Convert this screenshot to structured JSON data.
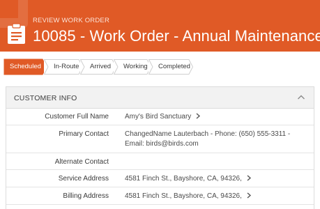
{
  "header": {
    "kicker": "REVIEW WORK ORDER",
    "title": "10085 - Work Order - Annual Maintenance",
    "icon": "clipboard-icon",
    "color": "#e05a26"
  },
  "path": {
    "steps": [
      {
        "label": "Scheduled",
        "active": true
      },
      {
        "label": "In-Route",
        "active": false
      },
      {
        "label": "Arrived",
        "active": false
      },
      {
        "label": "Working",
        "active": false
      },
      {
        "label": "Completed",
        "active": false
      }
    ]
  },
  "customer_info": {
    "title": "CUSTOMER INFO",
    "toggle_icon": "chevron-up-icon",
    "rows": [
      {
        "label": "Customer Full Name",
        "value": "Amy's Bird Sanctuary",
        "link": true
      },
      {
        "label": "Primary Contact",
        "value": "ChangedName Lauterbach - Phone: (650) 555-3311 -",
        "value2": "Email: birds@birds.com",
        "link": false
      },
      {
        "label": "Alternate Contact",
        "value": "",
        "link": false
      },
      {
        "label": "Service Address",
        "value": "4581 Finch St., Bayshore, CA, 94326,",
        "link": true
      },
      {
        "label": "Billing Address",
        "value": "4581 Finch St., Bayshore, CA, 94326,",
        "link": true
      }
    ]
  }
}
